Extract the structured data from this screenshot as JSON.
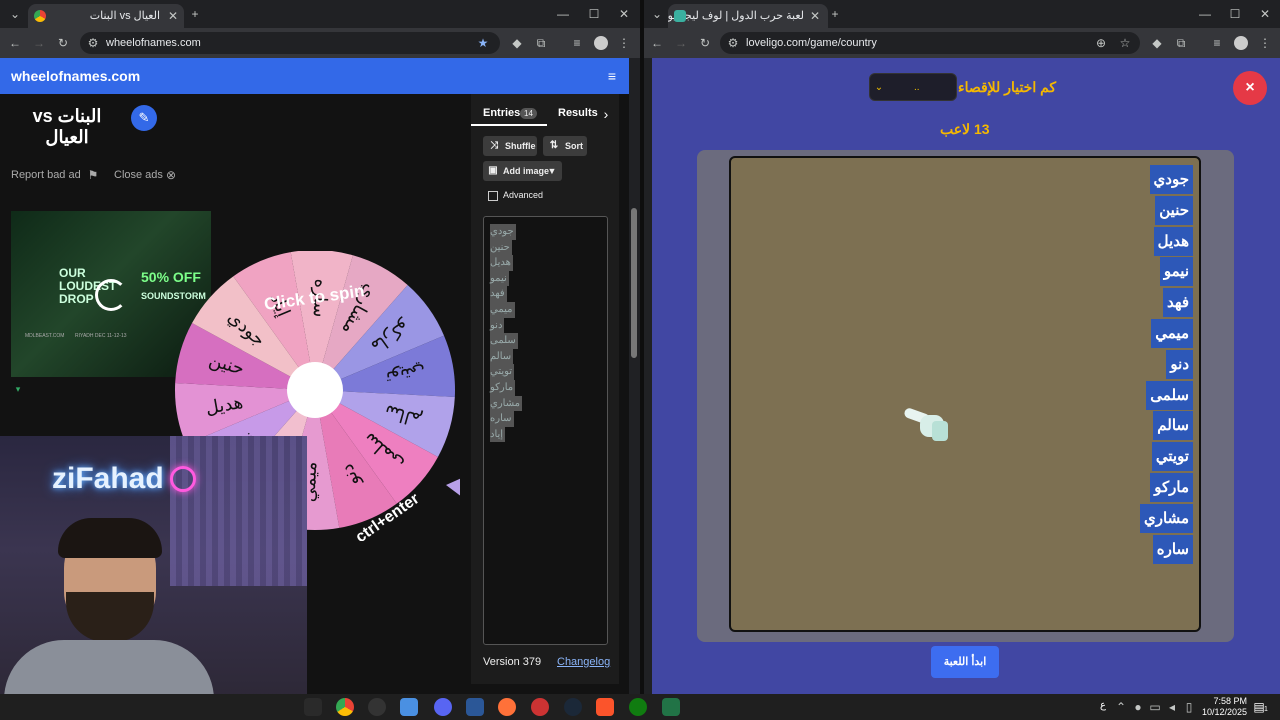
{
  "left_browser": {
    "tab_title": "العيال vs البنات",
    "url": "wheelofnames.com"
  },
  "wheel_app": {
    "brand": "wheelofnames.com",
    "wheel_title": "البنات vs العيال",
    "report_bad_ad": "Report bad ad",
    "close_ads": "Close ads",
    "ad": {
      "headline": "OUR LOUDEST DROP",
      "offer": "50% OFF",
      "brand": "SOUNDSTORM",
      "store": "MDLBEAST.COM",
      "event": "RIYADH DEC 11-12-13"
    },
    "wheel_center_text": "Click to spin",
    "wheel_hint": "ctrl+enter",
    "wheel_segments": [
      "ساره",
      "مشاري",
      "ماركو",
      "تويتي",
      "سالم",
      "سلمى",
      "دنو",
      "ميمي",
      "فهد",
      "نيمو",
      "هديل",
      "حنين",
      "جودي",
      "إياد"
    ],
    "tabs": {
      "entries_label": "Entries",
      "entries_count": "14",
      "results_label": "Results"
    },
    "buttons": {
      "shuffle": "Shuffle",
      "sort": "Sort",
      "add_image": "Add image",
      "advanced": "Advanced"
    },
    "entries": [
      "جودي",
      "حنين",
      "هديل",
      "نيمو",
      "فهد",
      "ميمي",
      "دنو",
      "سلمى",
      "سالم",
      "تويتي",
      "ماركو",
      "مشاري",
      "ساره",
      "إياد"
    ],
    "version": "Version 379",
    "changelog": "Changelog"
  },
  "right_browser": {
    "tab_title": "لعبة حرب الدول | لوف ليجو يوفر",
    "url": "loveligo.com/game/country"
  },
  "game": {
    "question_label": "كم اختيار للإقصاء",
    "select_value": "..",
    "players_count": "13 لاعب",
    "players": [
      "جودي",
      "حنين",
      "هديل",
      "نيمو",
      "فهد",
      "ميمي",
      "دنو",
      "سلمى",
      "سالم",
      "تويتي",
      "ماركو",
      "مشاري",
      "ساره"
    ],
    "start_button": "ابدأ اللعبة",
    "close_icon": "×"
  },
  "stream": {
    "overlay_name": "ziFahad"
  },
  "taskbar": {
    "lang": "ع",
    "time": "7:58 PM",
    "date": "10/12/2025",
    "notif_count": "1"
  },
  "colors": {
    "wheel_accent": "#3369e8",
    "game_bg": "#4147a3",
    "board_inner": "#7d7052",
    "tag_blue": "#2d58b8",
    "close_red": "#e53946"
  }
}
